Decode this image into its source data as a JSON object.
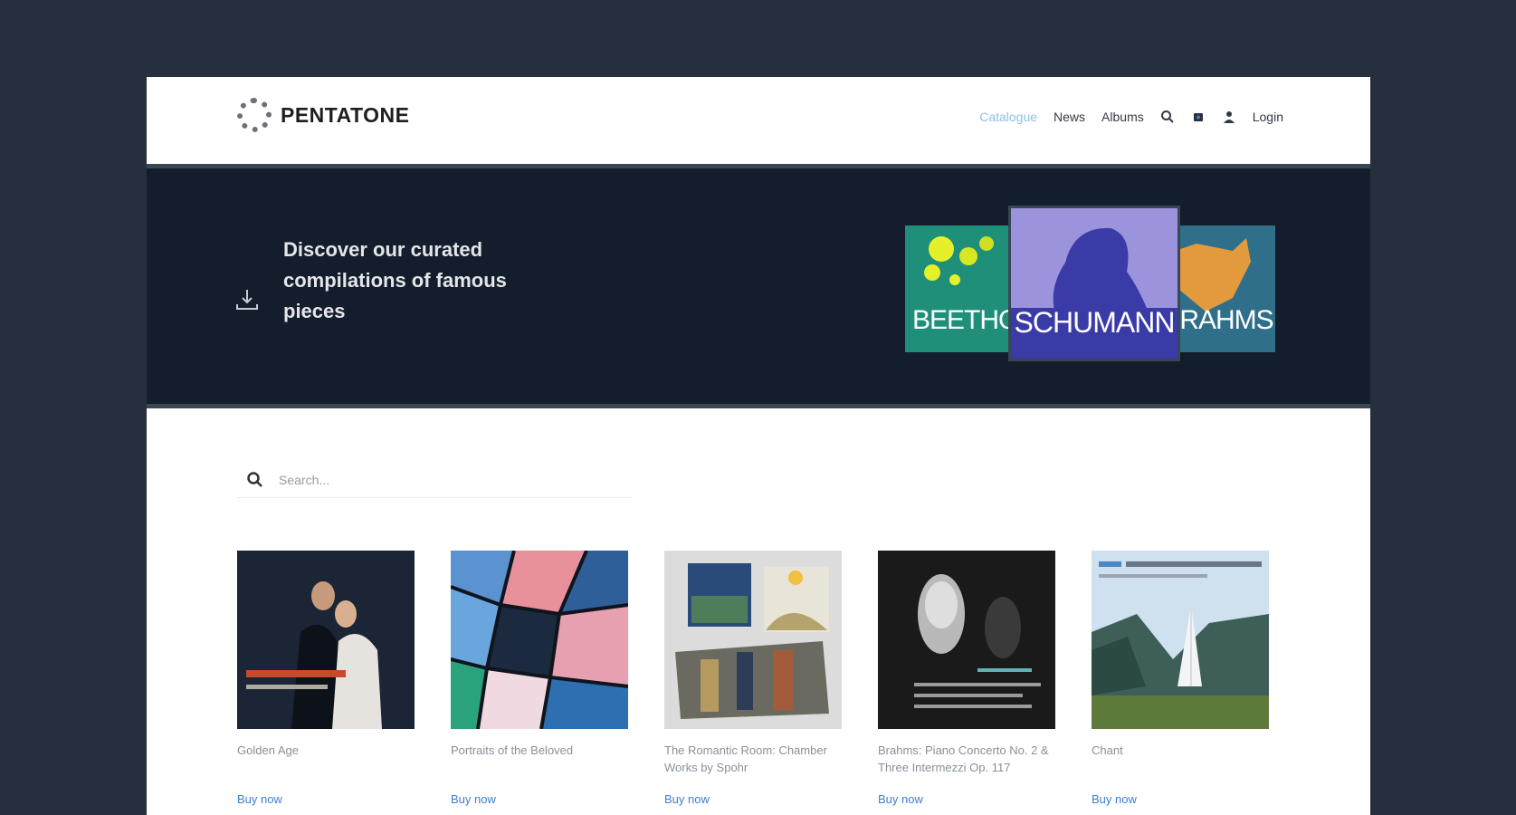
{
  "brand": {
    "name": "PENTATONE"
  },
  "nav": {
    "items": [
      {
        "label": "Catalogue",
        "active": true
      },
      {
        "label": "News",
        "active": false
      },
      {
        "label": "Albums",
        "active": false
      }
    ],
    "login_label": "Login",
    "icons": [
      "search-icon",
      "cart-icon",
      "user-icon"
    ]
  },
  "hero": {
    "text": "Discover our curated compilations of famous pieces",
    "covers": [
      {
        "title": "BEETHOVEN",
        "color": "#1f8f7a"
      },
      {
        "title": "SCHUMANN",
        "color": "#9b94dc"
      },
      {
        "title": "BRAHMS",
        "color": "#2f6f8a"
      }
    ]
  },
  "search": {
    "placeholder": "Search..."
  },
  "products": [
    {
      "title": "Golden Age",
      "link": "Buy now"
    },
    {
      "title": "Portraits of the Beloved",
      "link": "Buy now"
    },
    {
      "title": "The Romantic Room: Chamber Works by Spohr",
      "link": "Buy now"
    },
    {
      "title": "Brahms: Piano Concerto No. 2 & Three Intermezzi Op. 117",
      "link": "Buy now"
    },
    {
      "title": "Chant",
      "link": "Buy now"
    }
  ],
  "colors": {
    "accent": "#3c7fcf",
    "active_nav": "#8cc1e6",
    "hero_bg": "#141d2b",
    "page_bg": "#262f3e"
  }
}
